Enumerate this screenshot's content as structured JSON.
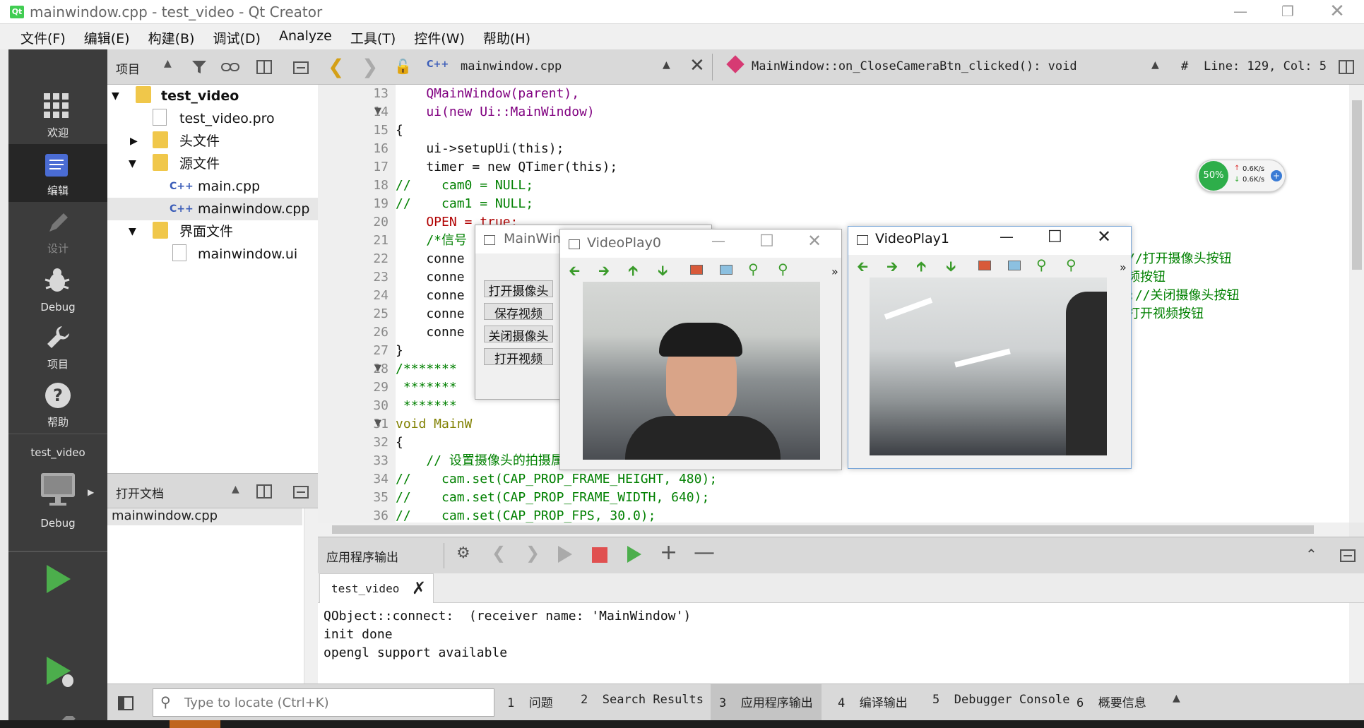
{
  "window": {
    "title": "mainwindow.cpp - test_video - Qt Creator",
    "logo": "qt"
  },
  "menu": [
    "文件(F)",
    "编辑(E)",
    "构建(B)",
    "调试(D)",
    "Analyze",
    "工具(T)",
    "控件(W)",
    "帮助(H)"
  ],
  "modes": [
    {
      "label": "欢迎",
      "icon": "grid-icon"
    },
    {
      "label": "编辑",
      "icon": "edit-doc-icon"
    },
    {
      "label": "设计",
      "icon": "pencil-icon"
    },
    {
      "label": "Debug",
      "icon": "bug-icon"
    },
    {
      "label": "项目",
      "icon": "wrench-icon"
    },
    {
      "label": "帮助",
      "icon": "help-icon"
    }
  ],
  "kit": {
    "project": "test_video",
    "target": "Debug"
  },
  "project_panel": {
    "title": "项目",
    "tree": [
      "test_video",
      "test_video.pro",
      "头文件",
      "源文件",
      "main.cpp",
      "mainwindow.cpp",
      "界面文件",
      "mainwindow.ui"
    ]
  },
  "open_docs": {
    "title": "打开文档",
    "items": [
      "mainwindow.cpp"
    ]
  },
  "editor": {
    "file": "mainwindow.cpp",
    "function": "MainWindow::on_CloseCameraBtn_clicked(): void",
    "hash": "#",
    "position": "Line: 129, Col: 5",
    "line_numbers": [
      "13",
      "14",
      "15",
      "16",
      "17",
      "18",
      "19",
      "20",
      "21",
      "22",
      "23",
      "24",
      "25",
      "26",
      "27",
      "28",
      "29",
      "30",
      "31",
      "32",
      "33",
      "34",
      "35",
      "36"
    ],
    "lines": [
      "    QMainWindow(parent),",
      "    ui(new Ui::MainWindow)",
      "{",
      "    ui->setupUi(this);",
      "    timer = new QTimer(this);",
      "//    cam0 = NULL;",
      "//    cam1 = NULL;",
      "    OPEN = true;",
      "    /*信号",
      "    conne",
      "    conne",
      "    conne",
      "    conne",
      "    conne",
      "}",
      "/*******",
      " *******",
      " *******",
      "void MainW",
      "{",
      "    // 设置摄像头的拍摄属性为 分辨率640x480, 帧率30fps",
      "//    cam.set(CAP_PROP_FRAME_HEIGHT, 480);",
      "//    cam.set(CAP_PROP_FRAME_WIDTH, 640);",
      "//    cam.set(CAP_PROP_FPS, 30.0);"
    ],
    "right_comments": [
      "//打开摄像头按钮",
      "频按钮",
      ";//关闭摄像头按钮",
      "打开视频按钮"
    ]
  },
  "net_widget": {
    "percent": "50%",
    "up": "0.6K/s",
    "down": "0.6K/s"
  },
  "mainwindow_app": {
    "title": "MainWin",
    "buttons": [
      "打开摄像头",
      "保存视频",
      "关闭摄像头",
      "打开视频"
    ]
  },
  "videoplay0": {
    "title": "VideoPlay0",
    "more": "»"
  },
  "videoplay1": {
    "title": "VideoPlay1",
    "more": "»"
  },
  "output": {
    "title": "应用程序输出",
    "tab": "test_video",
    "lines": [
      "QObject::connect:  (receiver name: 'MainWindow')",
      "init done",
      "opengl support available"
    ]
  },
  "statusbar": {
    "locator_placeholder": "Type to locate (Ctrl+K)",
    "panes": [
      {
        "num": "1",
        "label": "问题"
      },
      {
        "num": "2",
        "label": "Search Results"
      },
      {
        "num": "3",
        "label": "应用程序输出"
      },
      {
        "num": "4",
        "label": "编译输出"
      },
      {
        "num": "5",
        "label": "Debugger Console"
      },
      {
        "num": "6",
        "label": "概要信息"
      }
    ]
  },
  "colors": {
    "accent_green": "#41cd52",
    "run_green": "#4cae4c",
    "stop_red": "#e05050"
  }
}
